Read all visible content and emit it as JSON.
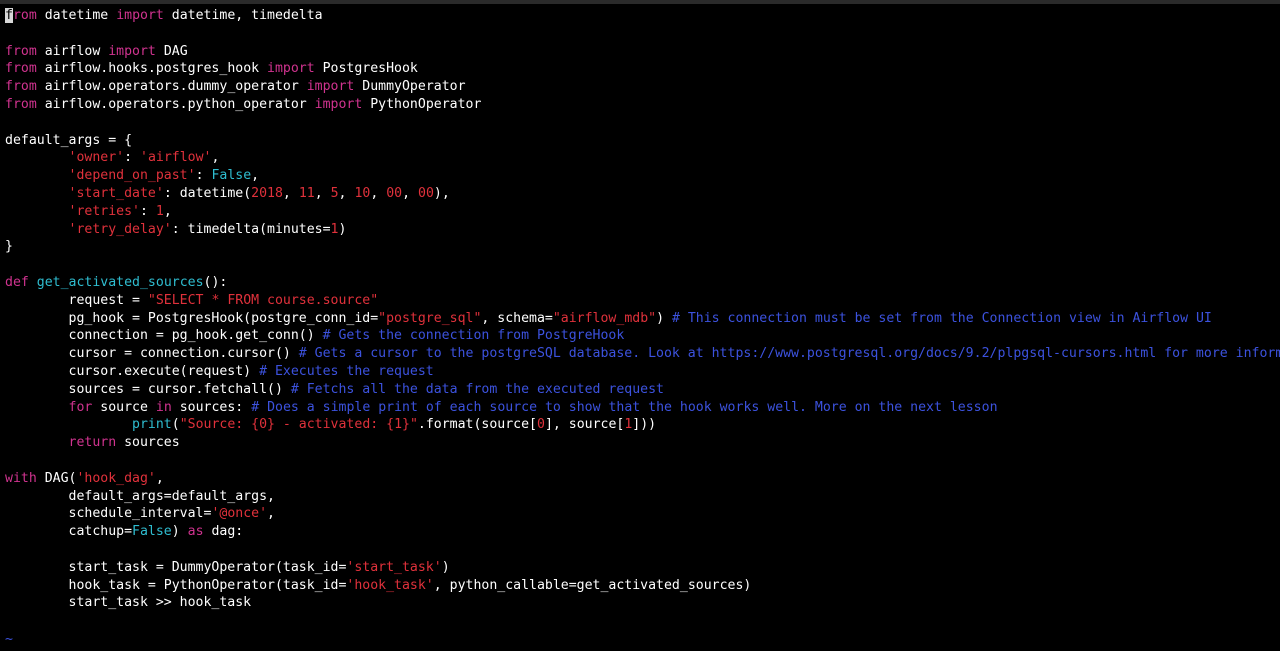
{
  "colors": {
    "default": "#ffffff",
    "keyword": "#d0338f",
    "string": "#e0313b",
    "number": "#e0313b",
    "constant": "#2fbdd0",
    "function_name": "#2fbdd0",
    "comment": "#3c52de",
    "cursor_bg": "#d8d8d8",
    "cursor_fg": "#000000",
    "tilde": "#3c52de"
  },
  "editor": {
    "cursor_char": "f",
    "lines": [
      [
        {
          "t": "rom ",
          "c": "keyword"
        },
        {
          "t": "datetime ",
          "c": "default"
        },
        {
          "t": "import",
          "c": "keyword"
        },
        {
          "t": " datetime, timedelta",
          "c": "default"
        }
      ],
      [],
      [
        {
          "t": "from",
          "c": "keyword"
        },
        {
          "t": " airflow ",
          "c": "default"
        },
        {
          "t": "import",
          "c": "keyword"
        },
        {
          "t": " DAG",
          "c": "default"
        }
      ],
      [
        {
          "t": "from",
          "c": "keyword"
        },
        {
          "t": " airflow.hooks.postgres_hook ",
          "c": "default"
        },
        {
          "t": "import",
          "c": "keyword"
        },
        {
          "t": " PostgresHook",
          "c": "default"
        }
      ],
      [
        {
          "t": "from",
          "c": "keyword"
        },
        {
          "t": " airflow.operators.dummy_operator ",
          "c": "default"
        },
        {
          "t": "import",
          "c": "keyword"
        },
        {
          "t": " DummyOperator",
          "c": "default"
        }
      ],
      [
        {
          "t": "from",
          "c": "keyword"
        },
        {
          "t": " airflow.operators.python_operator ",
          "c": "default"
        },
        {
          "t": "import",
          "c": "keyword"
        },
        {
          "t": " PythonOperator",
          "c": "default"
        }
      ],
      [],
      [
        {
          "t": "default_args = {",
          "c": "default"
        }
      ],
      [
        {
          "t": "        ",
          "c": "default"
        },
        {
          "t": "'owner'",
          "c": "string"
        },
        {
          "t": ": ",
          "c": "default"
        },
        {
          "t": "'airflow'",
          "c": "string"
        },
        {
          "t": ",",
          "c": "default"
        }
      ],
      [
        {
          "t": "        ",
          "c": "default"
        },
        {
          "t": "'depend_on_past'",
          "c": "string"
        },
        {
          "t": ": ",
          "c": "default"
        },
        {
          "t": "False",
          "c": "constant"
        },
        {
          "t": ",",
          "c": "default"
        }
      ],
      [
        {
          "t": "        ",
          "c": "default"
        },
        {
          "t": "'start_date'",
          "c": "string"
        },
        {
          "t": ": datetime(",
          "c": "default"
        },
        {
          "t": "2018",
          "c": "number"
        },
        {
          "t": ", ",
          "c": "default"
        },
        {
          "t": "11",
          "c": "number"
        },
        {
          "t": ", ",
          "c": "default"
        },
        {
          "t": "5",
          "c": "number"
        },
        {
          "t": ", ",
          "c": "default"
        },
        {
          "t": "10",
          "c": "number"
        },
        {
          "t": ", ",
          "c": "default"
        },
        {
          "t": "00",
          "c": "number"
        },
        {
          "t": ", ",
          "c": "default"
        },
        {
          "t": "00",
          "c": "number"
        },
        {
          "t": "),",
          "c": "default"
        }
      ],
      [
        {
          "t": "        ",
          "c": "default"
        },
        {
          "t": "'retries'",
          "c": "string"
        },
        {
          "t": ": ",
          "c": "default"
        },
        {
          "t": "1",
          "c": "number"
        },
        {
          "t": ",",
          "c": "default"
        }
      ],
      [
        {
          "t": "        ",
          "c": "default"
        },
        {
          "t": "'retry_delay'",
          "c": "string"
        },
        {
          "t": ": timedelta(minutes=",
          "c": "default"
        },
        {
          "t": "1",
          "c": "number"
        },
        {
          "t": ")",
          "c": "default"
        }
      ],
      [
        {
          "t": "}",
          "c": "default"
        }
      ],
      [],
      [
        {
          "t": "def",
          "c": "keyword"
        },
        {
          "t": " ",
          "c": "default"
        },
        {
          "t": "get_activated_sources",
          "c": "function_name"
        },
        {
          "t": "():",
          "c": "default"
        }
      ],
      [
        {
          "t": "        request = ",
          "c": "default"
        },
        {
          "t": "\"SELECT * FROM course.source\"",
          "c": "string"
        }
      ],
      [
        {
          "t": "        pg_hook = PostgresHook(postgre_conn_id=",
          "c": "default"
        },
        {
          "t": "\"postgre_sql\"",
          "c": "string"
        },
        {
          "t": ", schema=",
          "c": "default"
        },
        {
          "t": "\"airflow_mdb\"",
          "c": "string"
        },
        {
          "t": ") ",
          "c": "default"
        },
        {
          "t": "# This connection must be set from the Connection view in Airflow UI",
          "c": "comment"
        }
      ],
      [
        {
          "t": "        connection = pg_hook.get_conn() ",
          "c": "default"
        },
        {
          "t": "# Gets the connection from PostgreHook",
          "c": "comment"
        }
      ],
      [
        {
          "t": "        cursor = connection.cursor() ",
          "c": "default"
        },
        {
          "t": "# Gets a cursor to the postgreSQL database. Look at https://www.postgresql.org/docs/9.2/plpgsql-cursors.html for more information",
          "c": "comment"
        }
      ],
      [
        {
          "t": "        cursor.execute(request) ",
          "c": "default"
        },
        {
          "t": "# Executes the request",
          "c": "comment"
        }
      ],
      [
        {
          "t": "        sources = cursor.fetchall() ",
          "c": "default"
        },
        {
          "t": "# Fetchs all the data from the executed request",
          "c": "comment"
        }
      ],
      [
        {
          "t": "        ",
          "c": "default"
        },
        {
          "t": "for",
          "c": "keyword"
        },
        {
          "t": " source ",
          "c": "default"
        },
        {
          "t": "in",
          "c": "keyword"
        },
        {
          "t": " sources: ",
          "c": "default"
        },
        {
          "t": "# Does a simple print of each source to show that the hook works well. More on the next lesson",
          "c": "comment"
        }
      ],
      [
        {
          "t": "                ",
          "c": "default"
        },
        {
          "t": "print",
          "c": "function_name"
        },
        {
          "t": "(",
          "c": "default"
        },
        {
          "t": "\"Source: {0} - activated: {1}\"",
          "c": "string"
        },
        {
          "t": ".format(source[",
          "c": "default"
        },
        {
          "t": "0",
          "c": "number"
        },
        {
          "t": "], source[",
          "c": "default"
        },
        {
          "t": "1",
          "c": "number"
        },
        {
          "t": "]))",
          "c": "default"
        }
      ],
      [
        {
          "t": "        ",
          "c": "default"
        },
        {
          "t": "return",
          "c": "keyword"
        },
        {
          "t": " sources",
          "c": "default"
        }
      ],
      [],
      [
        {
          "t": "with",
          "c": "keyword"
        },
        {
          "t": " DAG(",
          "c": "default"
        },
        {
          "t": "'hook_dag'",
          "c": "string"
        },
        {
          "t": ",",
          "c": "default"
        }
      ],
      [
        {
          "t": "        default_args=default_args,",
          "c": "default"
        }
      ],
      [
        {
          "t": "        schedule_interval=",
          "c": "default"
        },
        {
          "t": "'@once'",
          "c": "string"
        },
        {
          "t": ",",
          "c": "default"
        }
      ],
      [
        {
          "t": "        catchup=",
          "c": "default"
        },
        {
          "t": "False",
          "c": "constant"
        },
        {
          "t": ") ",
          "c": "default"
        },
        {
          "t": "as",
          "c": "keyword"
        },
        {
          "t": " dag:",
          "c": "default"
        }
      ],
      [],
      [
        {
          "t": "        start_task = DummyOperator(task_id=",
          "c": "default"
        },
        {
          "t": "'start_task'",
          "c": "string"
        },
        {
          "t": ")",
          "c": "default"
        }
      ],
      [
        {
          "t": "        hook_task = PythonOperator(task_id=",
          "c": "default"
        },
        {
          "t": "'hook_task'",
          "c": "string"
        },
        {
          "t": ", python_callable=get_activated_sources)",
          "c": "default"
        }
      ],
      [
        {
          "t": "        start_task >> hook_task",
          "c": "default"
        }
      ]
    ],
    "empty_line_marker": "~"
  }
}
